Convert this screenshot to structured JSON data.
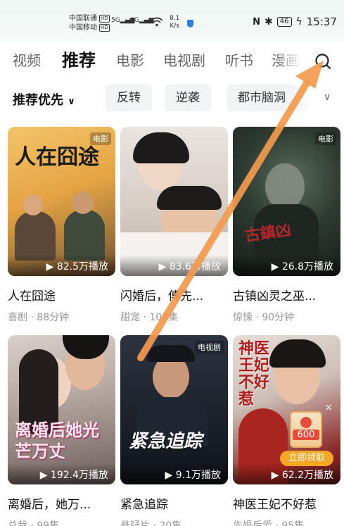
{
  "status_bar": {
    "carrier1": "中国联通",
    "carrier2": "中国移动",
    "hd": "HD",
    "net1": "5G",
    "net2": "4G",
    "speed_value": "8.1",
    "speed_unit": "K/s",
    "nfc": "N",
    "bluetooth": "✱",
    "battery": "46",
    "time": "15:37"
  },
  "tabs": [
    "视频",
    "推荐",
    "电影",
    "电视剧",
    "听书",
    "漫画"
  ],
  "filters": {
    "sort_label": "推荐优先",
    "chips": [
      "反转",
      "逆袭",
      "都市脑洞"
    ]
  },
  "cards": [
    {
      "title": "人在囧途",
      "meta": "喜剧 · 88分钟",
      "plays": "82.5万播放",
      "badge": "电影",
      "poster_text": "人在囧途"
    },
    {
      "title": "闪婚后，傅先...",
      "meta": "甜宠 · 100集",
      "plays": "83.6万播放",
      "badge": "",
      "poster_text": ""
    },
    {
      "title": "古镇凶灵之巫...",
      "meta": "惊悚 · 90分钟",
      "plays": "26.8万播放",
      "badge": "电影",
      "poster_text": ""
    },
    {
      "title": "离婚后，她万...",
      "meta": "总裁 · 99集",
      "plays": "192.4万播放",
      "badge": "",
      "poster_text": "离婚后她光芒万丈"
    },
    {
      "title": "紧急追踪",
      "meta": "悬疑片 · 20集",
      "plays": "9.1万播放",
      "badge": "电视剧",
      "poster_text": "紧急追踪"
    },
    {
      "title": "神医王妃不好惹",
      "meta": "先婚后爱 · 95集",
      "plays": "62.2万播放",
      "badge": "",
      "poster_text": "神医王妃不好惹"
    }
  ],
  "promo": {
    "amount": "600",
    "label": "立即领取"
  },
  "colors": {
    "arrow": "#f39a4e",
    "chip_bg": "#f2f3f5",
    "promo": "#f5a623"
  }
}
